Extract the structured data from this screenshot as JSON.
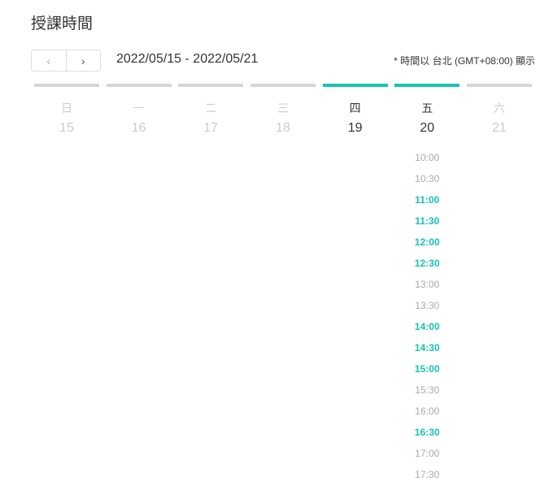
{
  "title": "授課時間",
  "nav": {
    "prev": "‹",
    "next": "›"
  },
  "range": "2022/05/15 - 2022/05/21",
  "timezone_note": "* 時間以 台北 (GMT+08:00) 顯示",
  "accent": "#15c4b0",
  "days": [
    {
      "dow": "日",
      "date": "15",
      "active": false,
      "slots": []
    },
    {
      "dow": "一",
      "date": "16",
      "active": false,
      "slots": []
    },
    {
      "dow": "二",
      "date": "17",
      "active": false,
      "slots": []
    },
    {
      "dow": "三",
      "date": "18",
      "active": false,
      "slots": []
    },
    {
      "dow": "四",
      "date": "19",
      "active": true,
      "slots": []
    },
    {
      "dow": "五",
      "date": "20",
      "active": true,
      "slots": [
        {
          "time": "10:00",
          "available": false
        },
        {
          "time": "10:30",
          "available": false
        },
        {
          "time": "11:00",
          "available": true
        },
        {
          "time": "11:30",
          "available": true
        },
        {
          "time": "12:00",
          "available": true
        },
        {
          "time": "12:30",
          "available": true
        },
        {
          "time": "13:00",
          "available": false
        },
        {
          "time": "13:30",
          "available": false
        },
        {
          "time": "14:00",
          "available": true
        },
        {
          "time": "14:30",
          "available": true
        },
        {
          "time": "15:00",
          "available": true
        },
        {
          "time": "15:30",
          "available": false
        },
        {
          "time": "16:00",
          "available": false
        },
        {
          "time": "16:30",
          "available": true
        },
        {
          "time": "17:00",
          "available": false
        },
        {
          "time": "17:30",
          "available": false
        }
      ]
    },
    {
      "dow": "六",
      "date": "21",
      "active": false,
      "slots": []
    }
  ]
}
